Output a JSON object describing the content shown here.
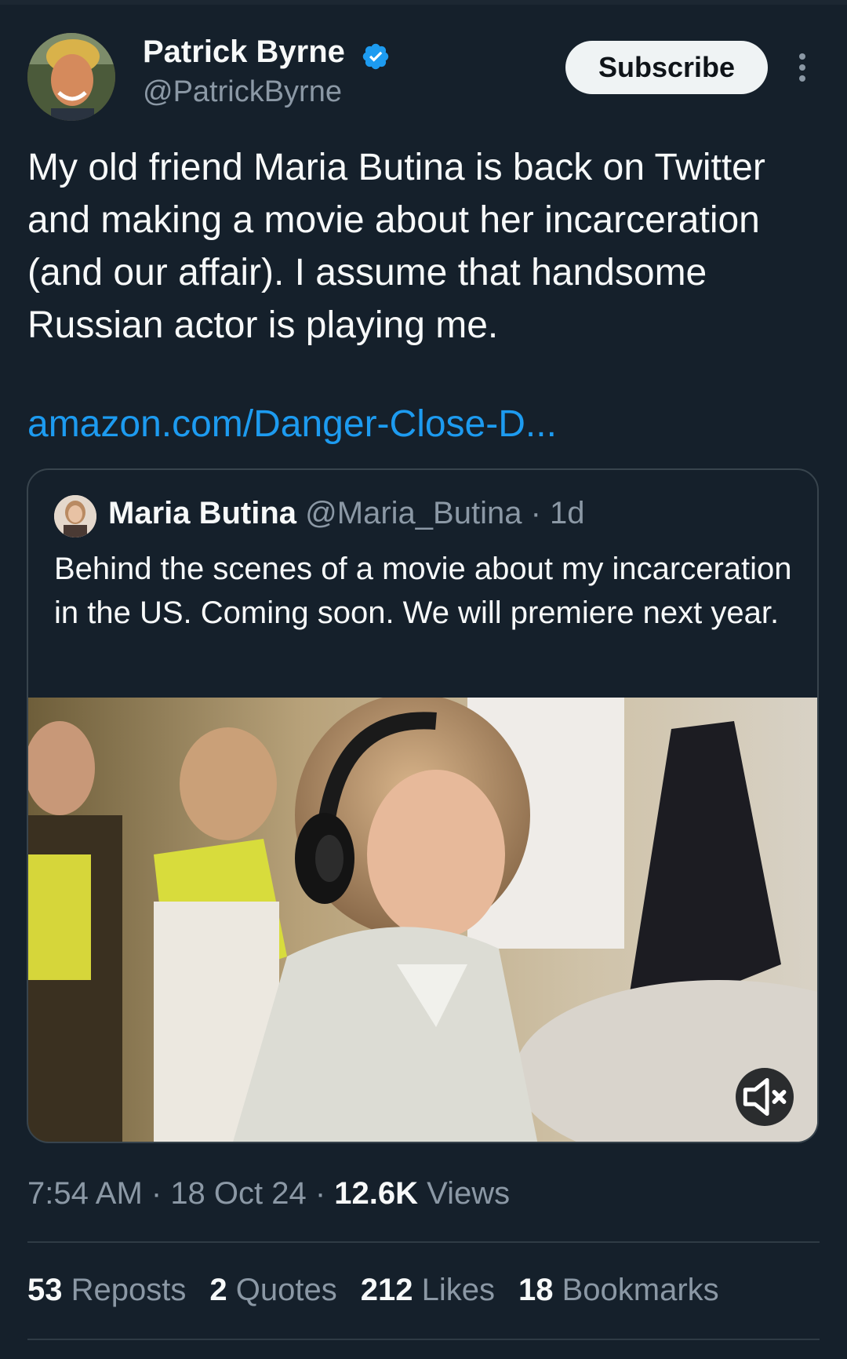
{
  "author": {
    "display_name": "Patrick Byrne",
    "handle": "@PatrickByrne",
    "verified": true
  },
  "header": {
    "subscribe_label": "Subscribe",
    "more_icon": "more-vertical-icon"
  },
  "tweet": {
    "text": "My old friend Maria Butina is back on Twitter and making a movie about her incarceration (and our affair). I assume that handsome Russian actor is playing me.",
    "link": "amazon.com/Danger-Close-D..."
  },
  "quote": {
    "display_name": "Maria Butina",
    "handle": "@Maria_Butina",
    "separator": " · ",
    "age": "1d",
    "text": "Behind the scenes of a movie about my incarceration in the US. Coming soon. We will premiere next year.",
    "media_icon": "muted-speaker-icon"
  },
  "meta": {
    "time": "7:54 AM",
    "date": "18 Oct 24",
    "sep": " · ",
    "views_count": "12.6K",
    "views_label": "Views"
  },
  "stats": [
    {
      "count": "53",
      "label": "Reposts"
    },
    {
      "count": "2",
      "label": "Quotes"
    },
    {
      "count": "212",
      "label": "Likes"
    },
    {
      "count": "18",
      "label": "Bookmarks"
    }
  ],
  "colors": {
    "background": "#15202b",
    "link": "#1d9bf0",
    "secondary_text": "#8b98a5",
    "verified": "#1d9bf0"
  }
}
